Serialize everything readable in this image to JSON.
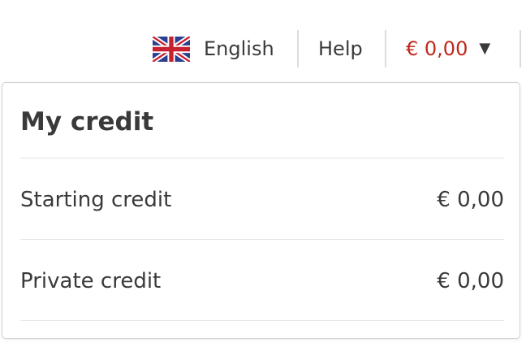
{
  "topbar": {
    "language": {
      "label": "English",
      "icon": "uk-flag-icon"
    },
    "help": {
      "label": "Help"
    },
    "balance": {
      "value": "€ 0,00",
      "icon": "caret-down-icon",
      "color": "#c0281b"
    }
  },
  "credit_panel": {
    "title": "My credit",
    "rows": [
      {
        "label": "Starting credit",
        "value": "€ 0,00"
      },
      {
        "label": "Private credit",
        "value": "€ 0,00"
      }
    ]
  }
}
